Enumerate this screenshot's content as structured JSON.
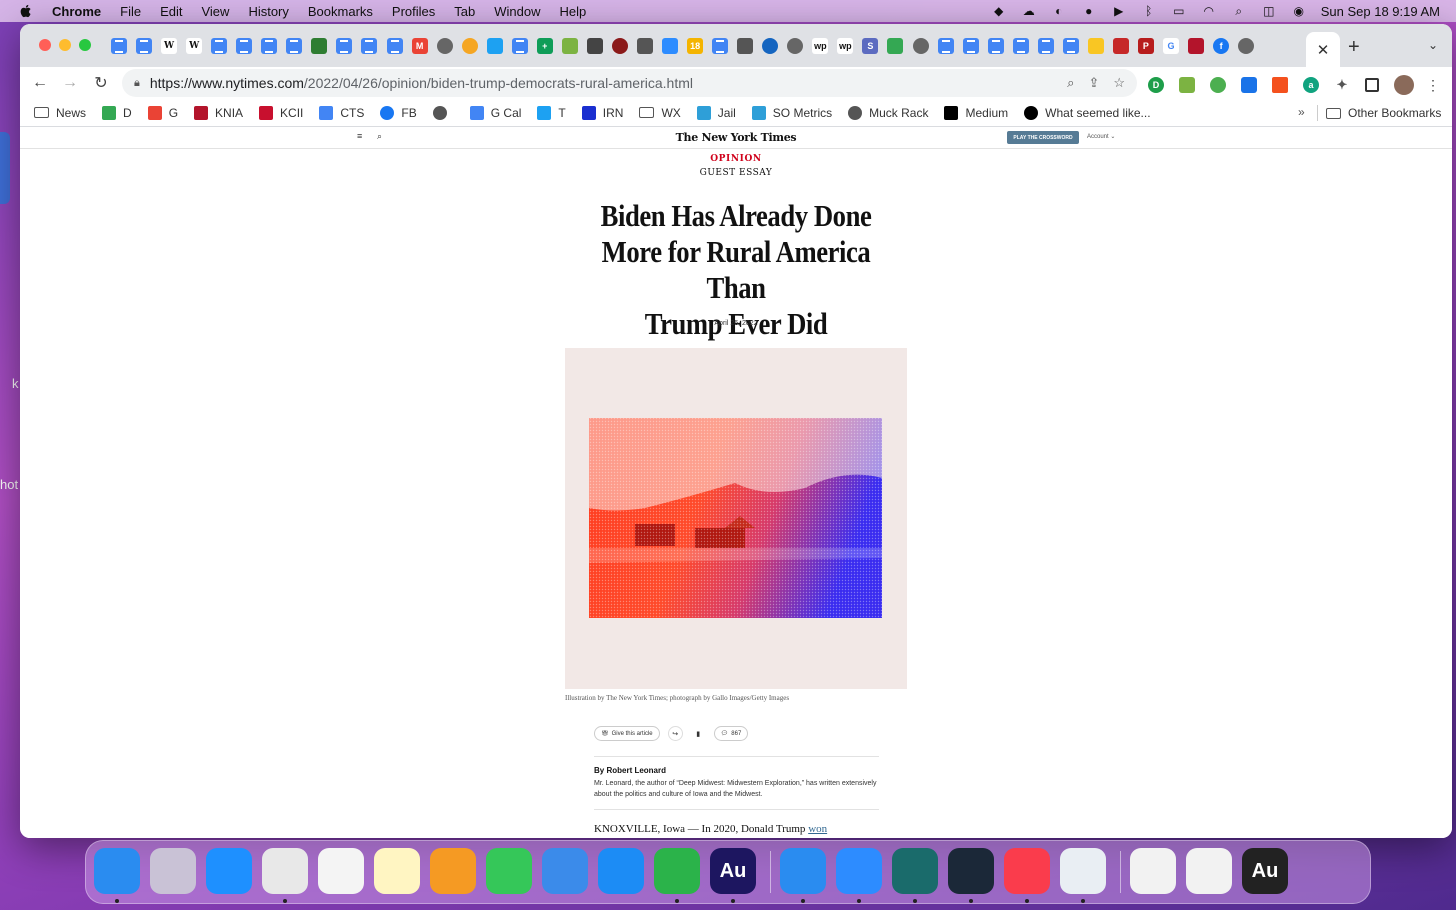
{
  "menubar": {
    "app": "Chrome",
    "items": [
      "File",
      "Edit",
      "View",
      "History",
      "Bookmarks",
      "Profiles",
      "Tab",
      "Window",
      "Help"
    ],
    "clock": "Sun Sep 18  9:19 AM"
  },
  "desktop": {
    "frag1": "k",
    "frag2": "hot"
  },
  "browser": {
    "url_host": "https://www.nytimes.com",
    "url_path": "/2022/04/26/opinion/biden-trump-democrats-rural-america.html",
    "new_tab": "+",
    "close_tab": "✕"
  },
  "bookmarks": [
    {
      "label": "News",
      "icon": "folder",
      "color": "#555"
    },
    {
      "label": "D",
      "icon": "drive",
      "color": "#34a853"
    },
    {
      "label": "G",
      "icon": "gmail",
      "color": "#ea4335"
    },
    {
      "label": "KNIA",
      "icon": "knia",
      "color": "#b3142b"
    },
    {
      "label": "KCII",
      "icon": "kcii",
      "color": "#c8102e"
    },
    {
      "label": "CTS",
      "icon": "google",
      "color": "#4285f4"
    },
    {
      "label": "FB",
      "icon": "facebook",
      "color": "#1877f2"
    },
    {
      "label": "",
      "icon": "globe",
      "color": "#555"
    },
    {
      "label": "G Cal",
      "icon": "calendar",
      "color": "#4285f4"
    },
    {
      "label": "T",
      "icon": "twitter",
      "color": "#1da1f2"
    },
    {
      "label": "IRN",
      "icon": "irn",
      "color": "#1a2fd0"
    },
    {
      "label": "WX",
      "icon": "folder",
      "color": "#555"
    },
    {
      "label": "Jail",
      "icon": "drop",
      "color": "#2e9fd8"
    },
    {
      "label": "SO Metrics",
      "icon": "drop",
      "color": "#2e9fd8"
    },
    {
      "label": "Muck Rack",
      "icon": "globe",
      "color": "#555"
    },
    {
      "label": "Medium",
      "icon": "medium",
      "color": "#000"
    },
    {
      "label": "What seemed like...",
      "icon": "abc",
      "color": "#000"
    }
  ],
  "bookmarks_more": "»",
  "other_bookmarks": "Other Bookmarks",
  "nyt": {
    "logo": "The New York Times",
    "crossword": "PLAY THE CROSSWORD",
    "account": "Account",
    "kicker": "OPINION",
    "subkicker": "GUEST ESSAY",
    "headline_l1": "Biden Has Already Done",
    "headline_l2": "More for Rural America Than",
    "headline_l3": "Trump Ever Did",
    "date": "April 26, 2022",
    "caption": "Illustration by The New York Times; photograph by Gallo Images/Getty Images",
    "gift": "Give this article",
    "comments": "867",
    "byline": "By Robert Leonard",
    "bio": "Mr. Leonard, the author of “Deep Midwest: Midwestern Exploration,” has written extensively about the politics and culture of Iowa and the Midwest.",
    "lede": "KNOXVILLE, Iowa — In 2020, Donald Trump ",
    "lede_link": "won"
  },
  "dock": {
    "apps": [
      {
        "name": "finder",
        "label": "",
        "color": "#2a8cf0"
      },
      {
        "name": "launchpad",
        "label": "",
        "color": "#c9c2d6"
      },
      {
        "name": "safari",
        "label": "",
        "color": "#1e90ff"
      },
      {
        "name": "chrome",
        "label": "",
        "color": "#e8e8e8"
      },
      {
        "name": "photos",
        "label": "",
        "color": "#f4f4f4"
      },
      {
        "name": "notes",
        "label": "",
        "color": "#fff5c2"
      },
      {
        "name": "pages",
        "label": "",
        "color": "#f59a23"
      },
      {
        "name": "numbers",
        "label": "",
        "color": "#35c759"
      },
      {
        "name": "keynote",
        "label": "",
        "color": "#3b8bea"
      },
      {
        "name": "app-store",
        "label": "",
        "color": "#1c8cf5"
      },
      {
        "name": "messages",
        "label": "",
        "color": "#2bb34a"
      },
      {
        "name": "audition",
        "label": "Au",
        "color": "#1d1660"
      },
      {
        "name": "bluetooth",
        "label": "",
        "color": "#2a8cf0"
      },
      {
        "name": "zoom",
        "label": "",
        "color": "#2d8cff"
      },
      {
        "name": "camo",
        "label": "",
        "color": "#1a6b6b"
      },
      {
        "name": "steam",
        "label": "",
        "color": "#1b2838"
      },
      {
        "name": "music",
        "label": "",
        "color": "#fa3c4c"
      },
      {
        "name": "preview",
        "label": "",
        "color": "#e9eef3"
      },
      {
        "name": "doc-thumb-1",
        "label": "",
        "color": "#f2f2f2"
      },
      {
        "name": "doc-thumb-2",
        "label": "",
        "color": "#f2f2f2"
      },
      {
        "name": "audition-window",
        "label": "Au",
        "color": "#222"
      },
      {
        "name": "trash",
        "label": "",
        "color": "#d8d8d8"
      }
    ]
  },
  "colors": {
    "nyt_red": "#d0021b",
    "link": "#326891",
    "crossword": "#567b95"
  }
}
